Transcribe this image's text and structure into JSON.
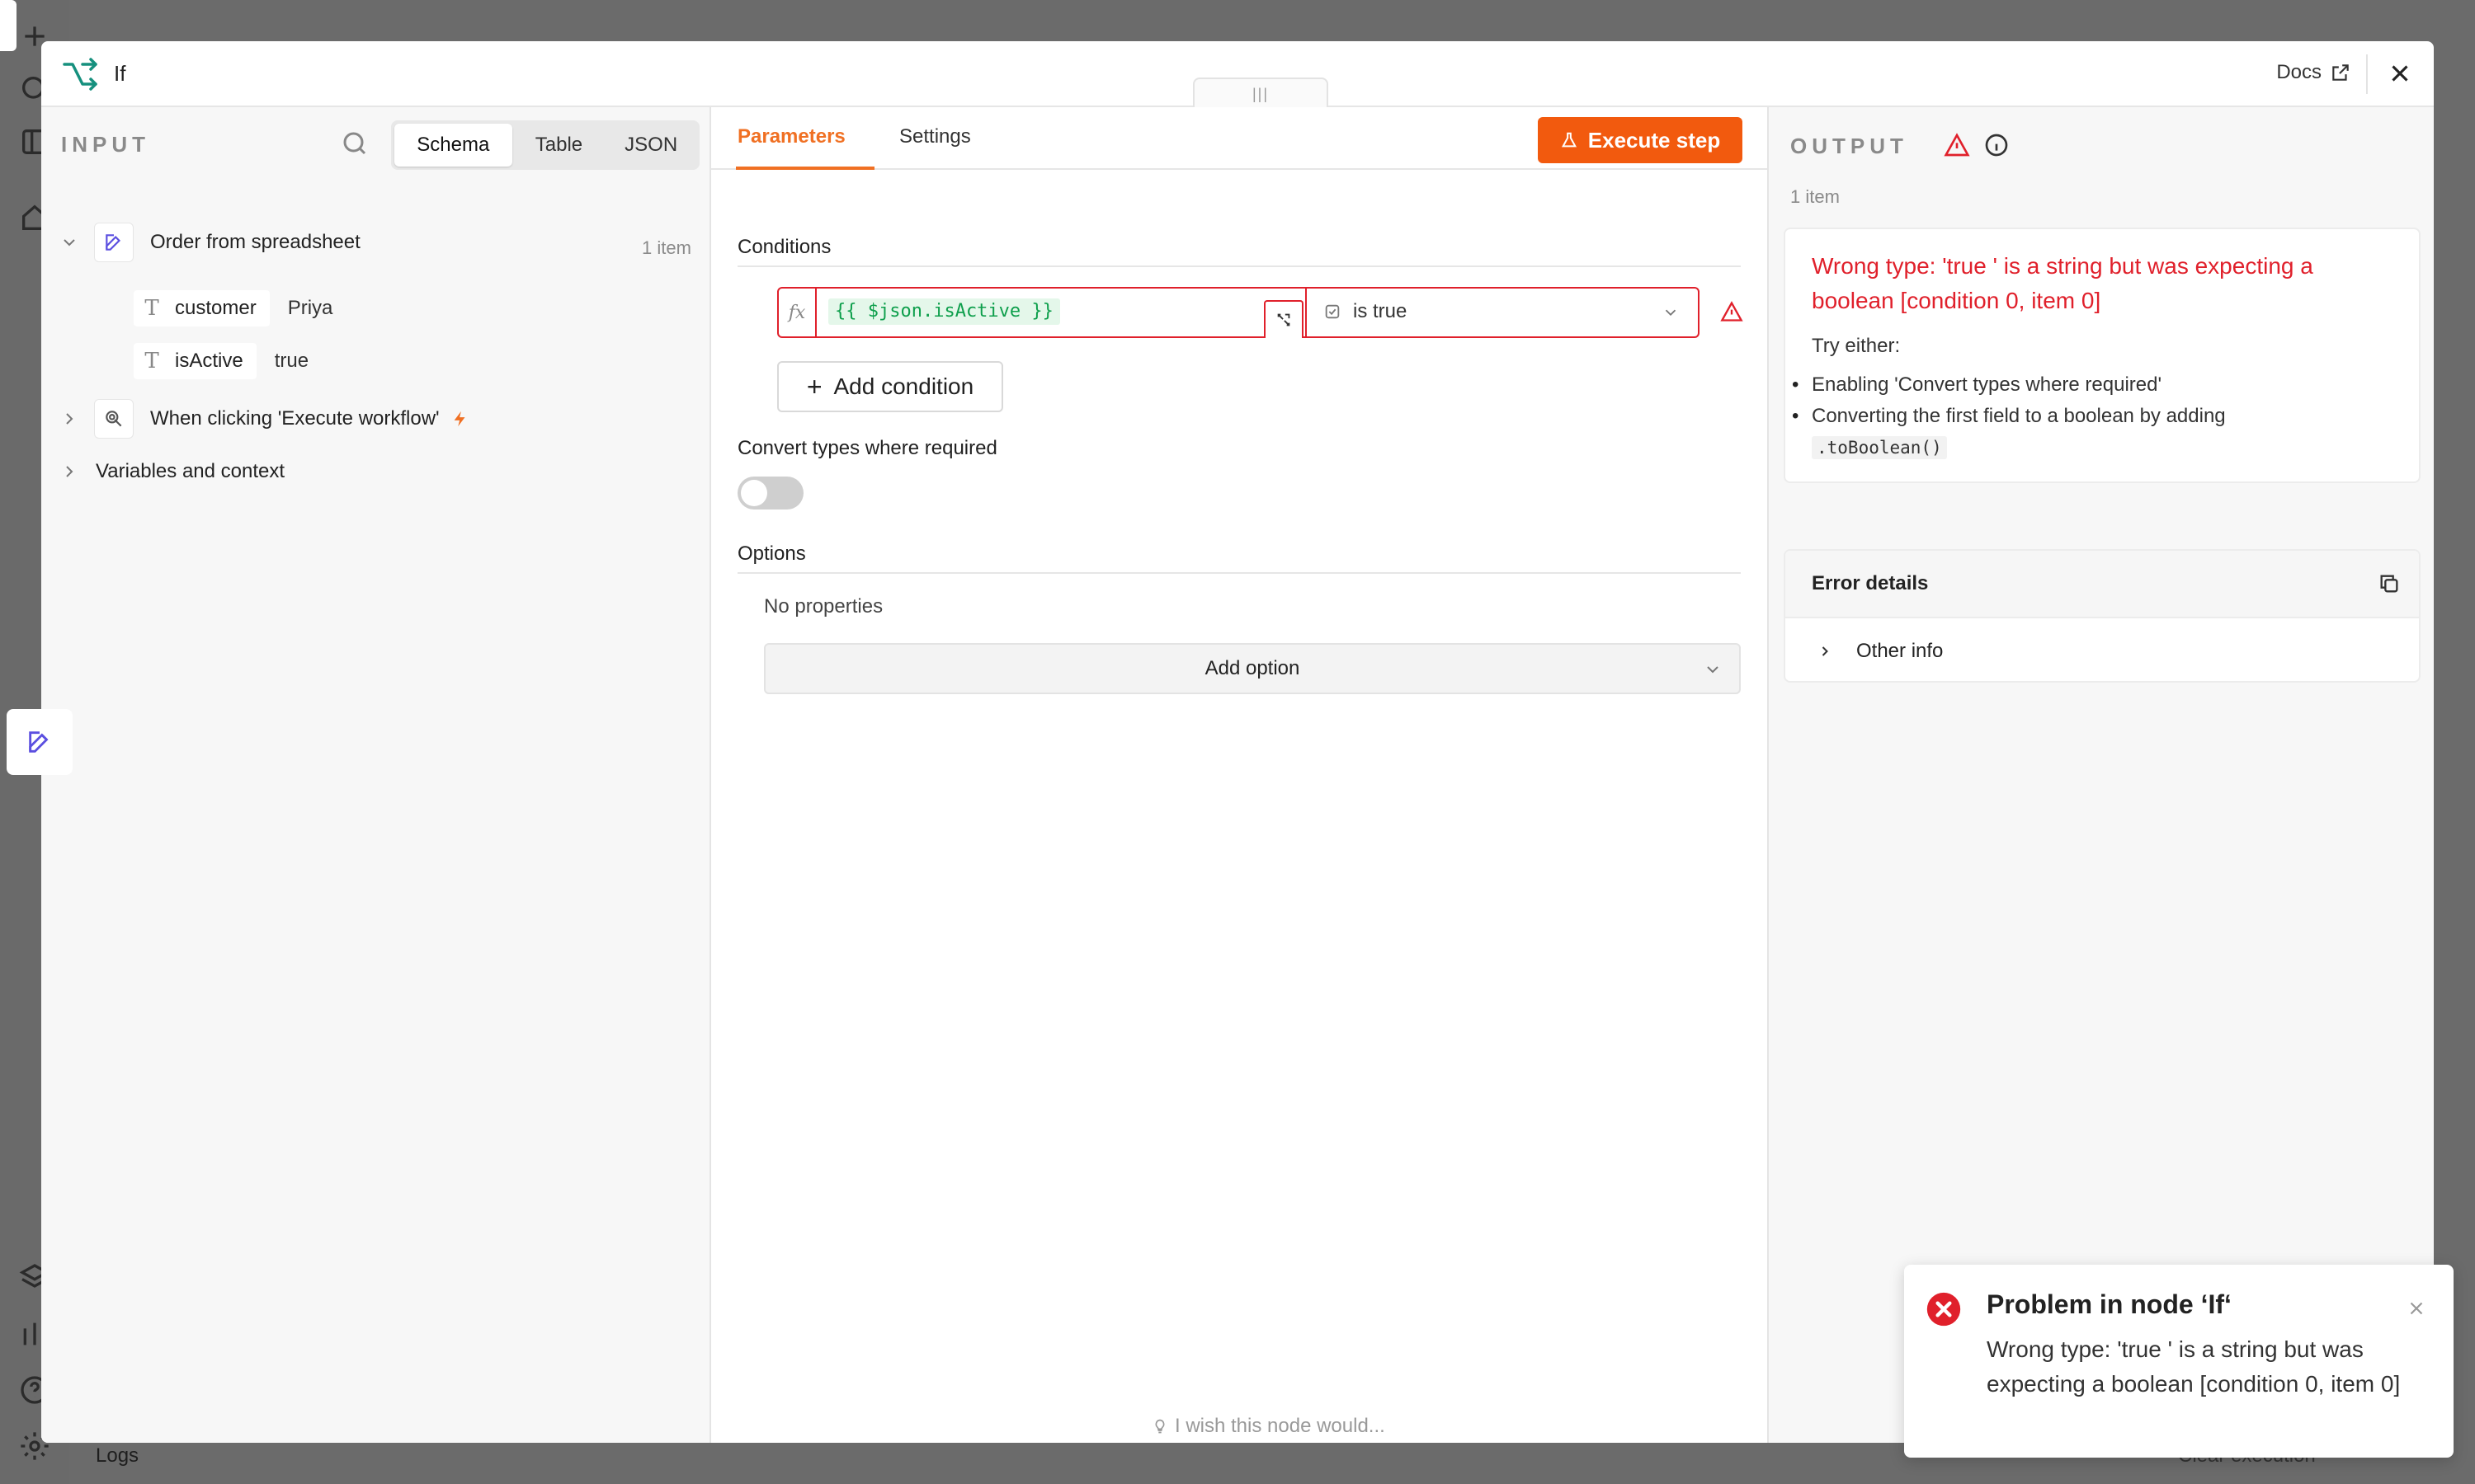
{
  "modal": {
    "title": "If",
    "docs_label": "Docs",
    "drag_handle": "|||"
  },
  "input": {
    "section_label": "INPUT",
    "view_tabs": [
      "Schema",
      "Table",
      "JSON"
    ],
    "active_tab": "Schema",
    "tree": {
      "node1": {
        "label": "Order from spreadsheet",
        "count": "1 item"
      },
      "fields": [
        {
          "name": "customer",
          "value": "Priya"
        },
        {
          "name": "isActive",
          "value": "true"
        }
      ],
      "node2": {
        "label": "When clicking 'Execute workflow'"
      },
      "variables": {
        "label": "Variables and context"
      }
    }
  },
  "params": {
    "tabs": [
      "Parameters",
      "Settings"
    ],
    "active_tab": "Parameters",
    "execute_label": "Execute step",
    "conditions_label": "Conditions",
    "condition": {
      "fx": "fx",
      "expression": "{{ $json.isActive }}",
      "operator": "is true"
    },
    "add_condition_label": "Add condition",
    "convert_label": "Convert types where required",
    "convert_enabled": false,
    "options_label": "Options",
    "no_properties": "No properties",
    "add_option_label": "Add option",
    "wish_label": "I wish this node would..."
  },
  "output": {
    "section_label": "OUTPUT",
    "items": "1 item",
    "error_title": "Wrong type: 'true ' is a string but was expecting a boolean [condition 0, item 0]",
    "try_label": "Try either:",
    "tips": {
      "tip1": "Enabling 'Convert types where required'",
      "tip2": "Converting the first field to a boolean by adding",
      "tip2_code": ".toBoolean()"
    },
    "details_title": "Error details",
    "other_info": "Other info"
  },
  "toast": {
    "title": "Problem in node ‘If‘",
    "message": "Wrong type: 'true ' is a string but was expecting a boolean [condition 0, item 0]"
  },
  "background": {
    "logs_label": "Logs",
    "clear_label": "Clear execution"
  },
  "colors": {
    "accent": "#f25a0e",
    "error": "#e0202b",
    "expression_green": "#0e9f4c",
    "node_teal": "#16907e"
  }
}
